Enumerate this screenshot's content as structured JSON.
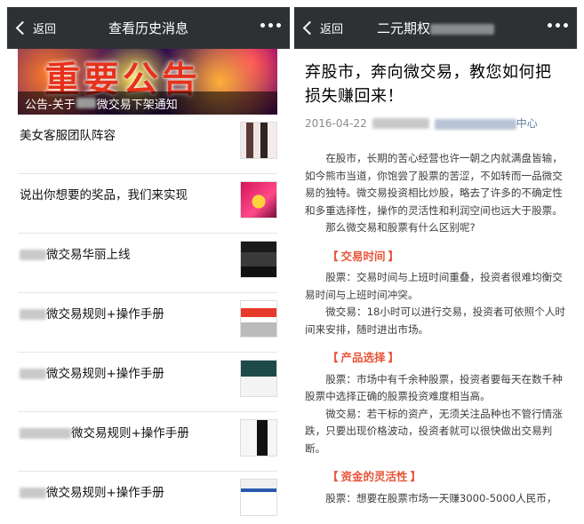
{
  "left": {
    "nav": {
      "back_label": "返回",
      "title": "查看历史消息"
    },
    "banner": {
      "art_text": "重要公告",
      "caption_prefix": "公告-关于",
      "caption_suffix": "微交易下架通知"
    },
    "items": [
      {
        "label": "美女客服团队阵容"
      },
      {
        "label": "说出你想要的奖品，我们来实现"
      },
      {
        "label": "微交易华丽上线"
      },
      {
        "label": "微交易规则+操作手册"
      },
      {
        "label": "微交易规则+操作手册"
      },
      {
        "label": "微交易规则+操作手册"
      },
      {
        "label": "微交易规则+操作手册"
      }
    ]
  },
  "right": {
    "nav": {
      "back_label": "返回",
      "title": "二元期权"
    },
    "article": {
      "title": "弃股市，奔向微交易，教您如何把损失赚回来！",
      "date": "2016-04-22",
      "source_suffix": "中心",
      "intro": [
        "在股市，长期的苦心经营也许一朝之内就满盘皆输，如今熊市当道，你饱尝了股票的苦涩，不如转而一品微交易的独特。微交易投资相比炒股，略去了许多的不确定性和多重选择性，操作的灵活性和利润空间也远大于股票。",
        "那么微交易和股票有什么区别呢?"
      ],
      "sections": [
        {
          "heading": "交易时间",
          "paragraphs": [
            "股票：交易时间与上班时间重叠，投资者很难均衡交易时间与上班时间冲突。",
            "微交易：18小时可以进行交易，投资者可依照个人时间来安排，随时进出市场。"
          ]
        },
        {
          "heading": "产品选择",
          "paragraphs": [
            "股票：市场中有千余种股票，投资者要每天在数千种股票中选择正确的股票投资难度相当高。",
            "微交易：若干标的资产，无须关注品种也不管行情涨跌，只要出现价格波动，投资者就可以很快做出交易判断。"
          ]
        },
        {
          "heading": "资金的灵活性",
          "paragraphs": [
            "股票：想要在股票市场一天赚3000-5000人民币，"
          ]
        }
      ]
    }
  }
}
